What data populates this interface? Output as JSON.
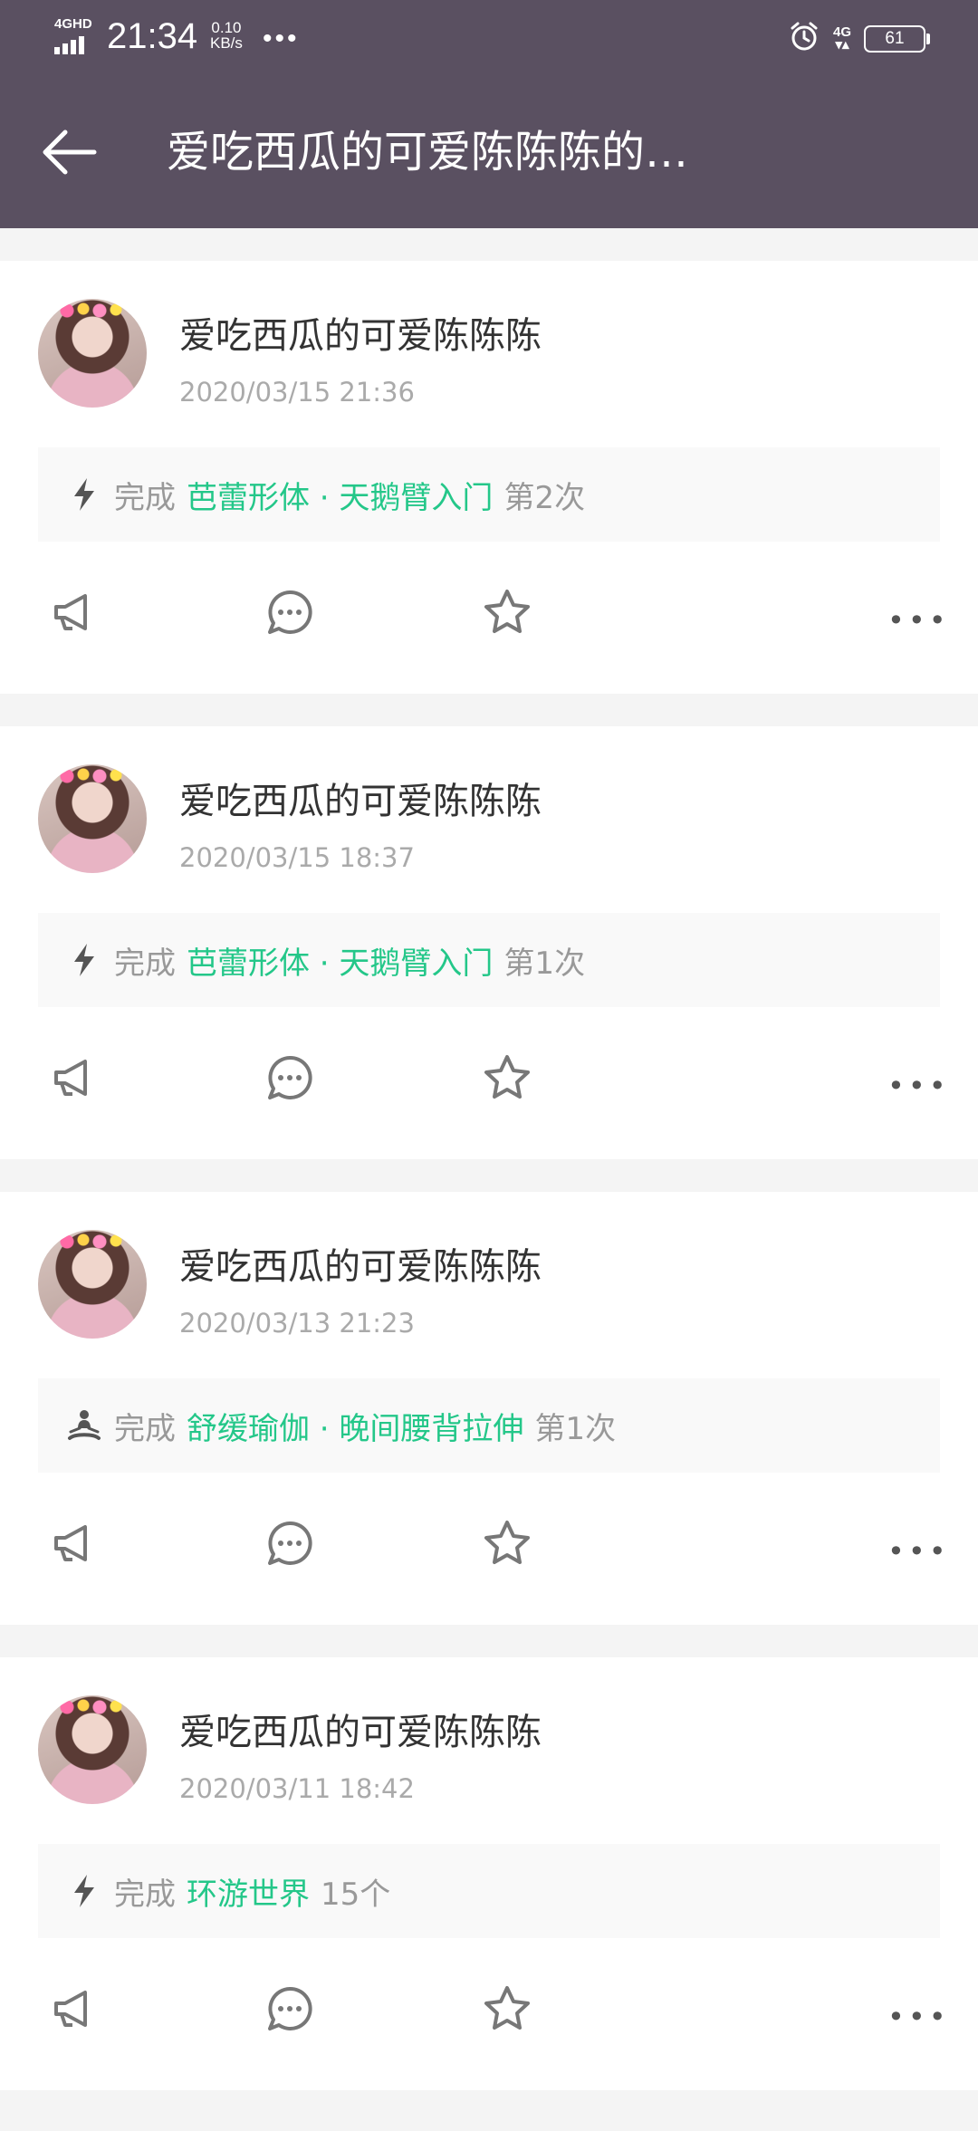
{
  "status_bar": {
    "signal": "4GHD",
    "time": "21:34",
    "speed_value": "0.10",
    "speed_unit": "KB/s",
    "more": "•••",
    "network": "4G",
    "battery": "61"
  },
  "header": {
    "title": "爱吃西瓜的可爱陈陈陈的…"
  },
  "posts": [
    {
      "name": "爱吃西瓜的可爱陈陈陈",
      "time": "2020/03/15 21:36",
      "icon": "bolt-icon",
      "done": "完成",
      "course": "芭蕾形体 · 天鹅臂入门",
      "count": "第2次"
    },
    {
      "name": "爱吃西瓜的可爱陈陈陈",
      "time": "2020/03/15 18:37",
      "icon": "bolt-icon",
      "done": "完成",
      "course": "芭蕾形体 · 天鹅臂入门",
      "count": "第1次"
    },
    {
      "name": "爱吃西瓜的可爱陈陈陈",
      "time": "2020/03/13 21:23",
      "icon": "meditation-icon",
      "done": "完成",
      "course": "舒缓瑜伽 · 晚间腰背拉伸",
      "count": "第1次"
    },
    {
      "name": "爱吃西瓜的可爱陈陈陈",
      "time": "2020/03/11 18:42",
      "icon": "bolt-icon",
      "done": "完成",
      "course": "环游世界",
      "count": "15个"
    }
  ],
  "actions": {
    "more": "•••"
  },
  "colors": {
    "header_bg": "#5a5061",
    "accent_green": "#24c789"
  }
}
